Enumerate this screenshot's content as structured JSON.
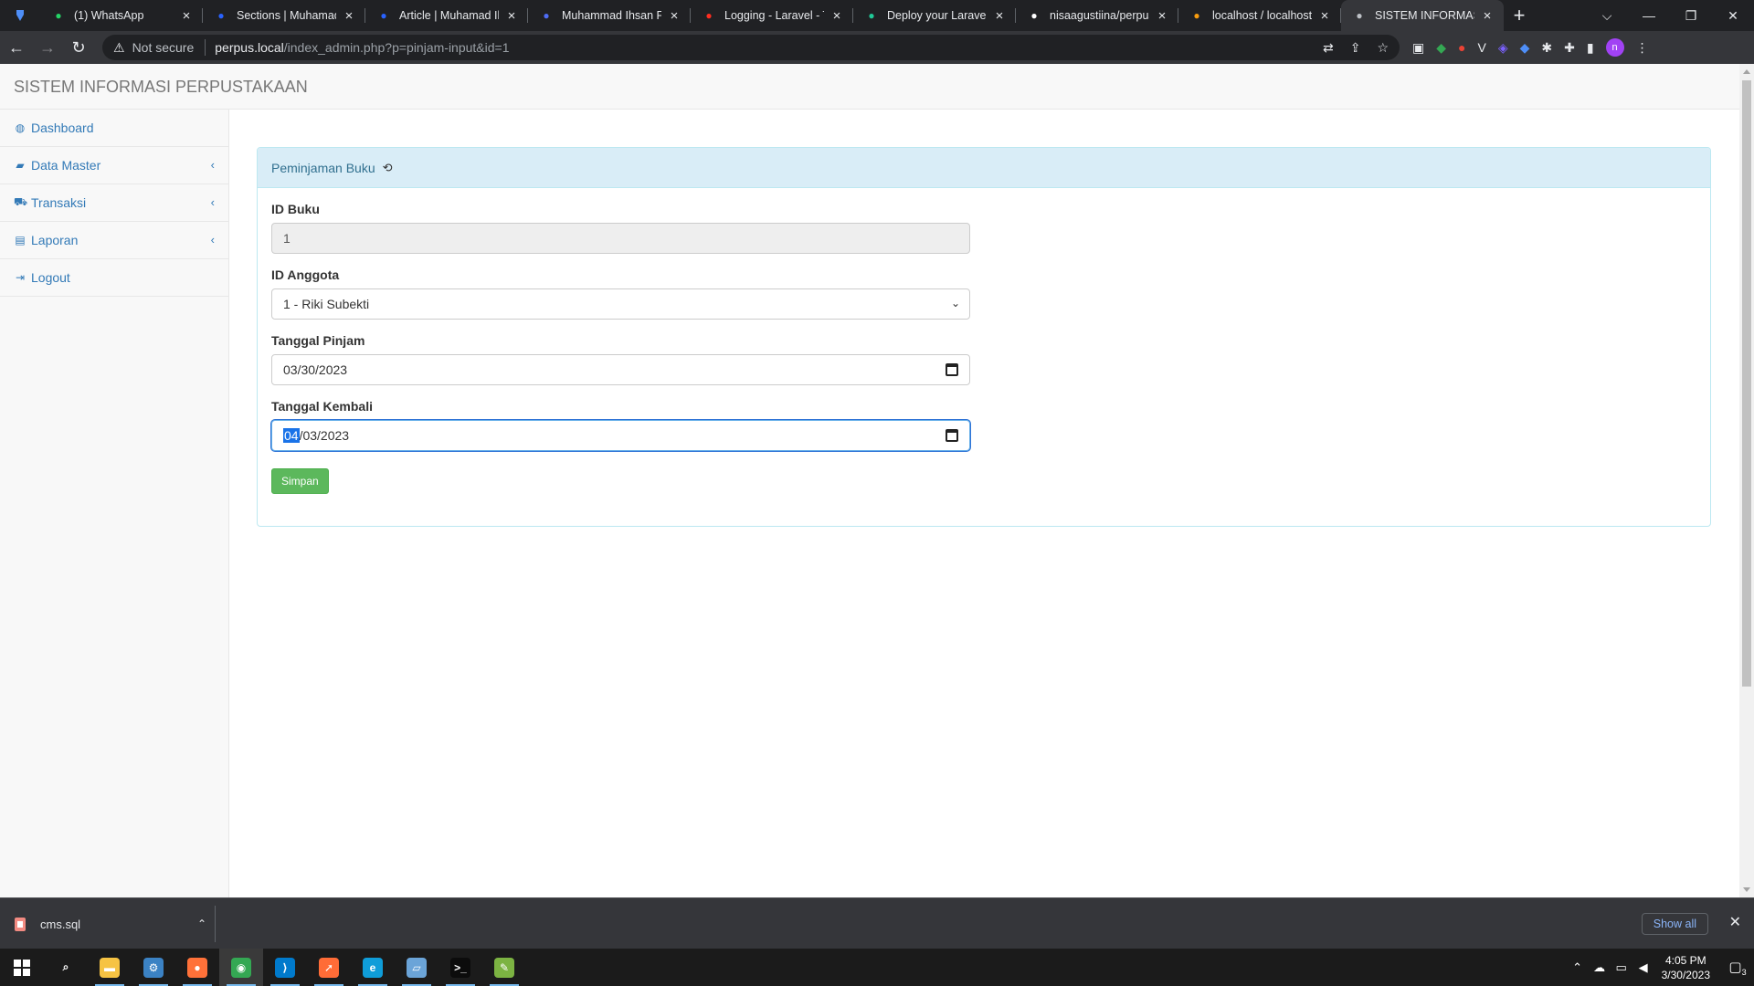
{
  "browser": {
    "tabs": [
      {
        "title": "(1) WhatsApp",
        "icon": "whatsapp-icon",
        "color": "#25d366"
      },
      {
        "title": "Sections | Muhamad",
        "icon": "hashnode-icon",
        "color": "#2962ff"
      },
      {
        "title": "Article | Muhamad Ih",
        "icon": "hashnode-icon",
        "color": "#2962ff"
      },
      {
        "title": "Muhammad Ihsan Fir",
        "icon": "f-logo-icon",
        "color": "#4f6df5"
      },
      {
        "title": "Logging - Laravel - Th",
        "icon": "laravel-icon",
        "color": "#ff2d20"
      },
      {
        "title": "Deploy your Laravel P",
        "icon": "f-logo-icon",
        "color": "#20c997"
      },
      {
        "title": "nisaagustiina/perpus",
        "icon": "github-icon",
        "color": "#ffffff"
      },
      {
        "title": "localhost / localhost /",
        "icon": "phpmyadmin-icon",
        "color": "#f89c0e"
      },
      {
        "title": "SISTEM INFORMASI P",
        "icon": "globe-icon",
        "color": "#bdc1c6",
        "active": true
      }
    ],
    "new_tab_glyph": "+",
    "address": {
      "security_text": "Not secure",
      "host": "perpus.local",
      "path": "/index_admin.php?p=pinjam-input&id=1"
    }
  },
  "app": {
    "brand": "SISTEM INFORMASI PERPUSTAKAAN",
    "sidebar": [
      {
        "label": "Dashboard",
        "icon": "dashboard-icon",
        "glyph": "◍",
        "has_caret": false
      },
      {
        "label": "Data Master",
        "icon": "book-icon",
        "glyph": "▰",
        "has_caret": true
      },
      {
        "label": "Transaksi",
        "icon": "cart-icon",
        "glyph": "⛟",
        "has_caret": true
      },
      {
        "label": "Laporan",
        "icon": "list-alt-icon",
        "glyph": "▤",
        "has_caret": true
      },
      {
        "label": "Logout",
        "icon": "logout-icon",
        "glyph": "⇥",
        "has_caret": false
      }
    ],
    "panel": {
      "title": "Peminjaman Buku",
      "fields": {
        "id_buku": {
          "label": "ID Buku",
          "value": "1"
        },
        "id_anggota": {
          "label": "ID Anggota",
          "value": "1 - Riki Subekti"
        },
        "tanggal_pinjam": {
          "label": "Tanggal Pinjam",
          "value": "03/30/2023"
        },
        "tanggal_kembali": {
          "label": "Tanggal Kembali",
          "month": "04",
          "rest": "/03/2023"
        }
      },
      "submit_label": "Simpan"
    }
  },
  "downloads": {
    "file_name": "cms.sql",
    "show_all_label": "Show all"
  },
  "taskbar": {
    "apps": [
      {
        "name": "search-icon",
        "glyph": "⌕",
        "color": "transparent"
      },
      {
        "name": "file-explorer-icon",
        "glyph": "▬",
        "color": "#f6c343"
      },
      {
        "name": "network-app-icon",
        "glyph": "⚙",
        "color": "#3b82c4"
      },
      {
        "name": "firefox-icon",
        "glyph": "●",
        "color": "#ff7139"
      },
      {
        "name": "chrome-icon",
        "glyph": "◉",
        "color": "#34a853"
      },
      {
        "name": "vscode-icon",
        "glyph": "⟩",
        "color": "#007acc"
      },
      {
        "name": "postman-icon",
        "glyph": "➚",
        "color": "#ff6c37"
      },
      {
        "name": "edge-icon",
        "glyph": "e",
        "color": "#0f9dd9"
      },
      {
        "name": "notes-icon",
        "glyph": "▱",
        "color": "#6ba4d8"
      },
      {
        "name": "terminal-icon",
        "glyph": ">_",
        "color": "#0c0c0c"
      },
      {
        "name": "notepadpp-icon",
        "glyph": "✎",
        "color": "#7cb342"
      }
    ],
    "clock_time": "4:05 PM",
    "clock_date": "3/30/2023",
    "notification_count": "3"
  }
}
